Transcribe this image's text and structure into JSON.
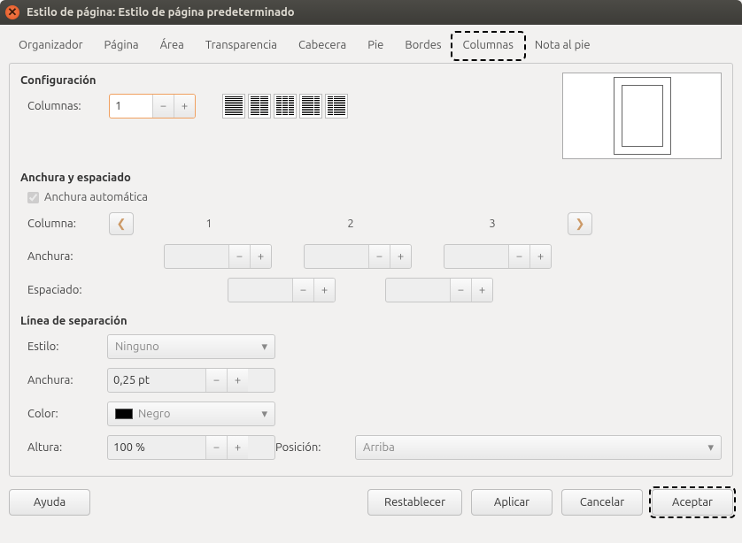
{
  "window": {
    "title": "Estilo de página: Estilo de página predeterminado"
  },
  "tabs": [
    "Organizador",
    "Página",
    "Área",
    "Transparencia",
    "Cabecera",
    "Pie",
    "Bordes",
    "Columnas",
    "Nota al pie"
  ],
  "active_tab_index": 7,
  "config": {
    "section_title": "Configuración",
    "columns_label": "Columnas:",
    "columns_value": "1"
  },
  "width_spacing": {
    "section_title": "Anchura y espaciado",
    "auto_label": "Anchura automática",
    "auto_checked": true,
    "column_label": "Columna:",
    "col_headers": [
      "1",
      "2",
      "3"
    ],
    "width_label": "Anchura:",
    "widths": [
      "",
      "",
      ""
    ],
    "spacing_label": "Espaciado:",
    "spacings": [
      "",
      ""
    ]
  },
  "separator": {
    "section_title": "Línea de separación",
    "style_label": "Estilo:",
    "style_value": "Ninguno",
    "width_label": "Anchura:",
    "width_value": "0,25 pt",
    "color_label": "Color:",
    "color_value": "Negro",
    "height_label": "Altura:",
    "height_value": "100 %",
    "position_label": "Posición:",
    "position_value": "Arriba"
  },
  "buttons": {
    "help": "Ayuda",
    "reset": "Restablecer",
    "apply": "Aplicar",
    "cancel": "Cancelar",
    "accept": "Aceptar"
  },
  "icons": {
    "close": "✕",
    "minus": "−",
    "plus": "+",
    "left": "❮",
    "right": "❯",
    "caret": "▾"
  }
}
